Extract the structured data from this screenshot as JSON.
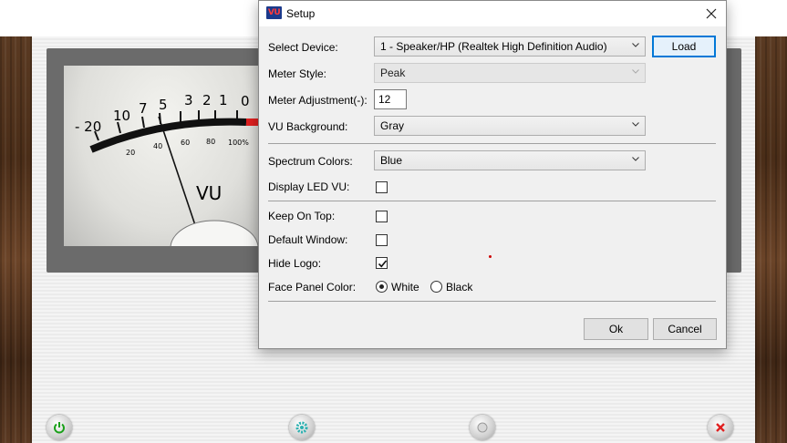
{
  "dialog": {
    "title": "Setup",
    "app_icon_text": "VU",
    "labels": {
      "select_device": "Select Device:",
      "meter_style": "Meter Style:",
      "meter_adjustment": "Meter Adjustment(-):",
      "vu_background": "VU Background:",
      "spectrum_colors": "Spectrum Colors:",
      "display_led_vu": "Display LED VU:",
      "keep_on_top": "Keep On Top:",
      "default_window": "Default Window:",
      "hide_logo": "Hide Logo:",
      "face_panel_color": "Face Panel Color:"
    },
    "values": {
      "select_device": "1 - Speaker/HP (Realtek High Definition Audio)",
      "meter_style": "Peak",
      "meter_adjustment": "12",
      "vu_background": "Gray",
      "spectrum_colors": "Blue"
    },
    "checkboxes": {
      "display_led_vu": false,
      "keep_on_top": false,
      "default_window": false,
      "hide_logo": true
    },
    "face_panel_options": [
      "White",
      "Black"
    ],
    "face_panel_selected": "White",
    "buttons": {
      "load": "Load",
      "ok": "Ok",
      "cancel": "Cancel"
    }
  },
  "meter": {
    "scale_top": [
      "- 20",
      "10",
      "7",
      "5",
      "3",
      "2",
      "1",
      "0"
    ],
    "scale_bottom": [
      "20",
      "40",
      "60",
      "80",
      "100%"
    ],
    "label": "VU"
  },
  "bottom_buttons": [
    "power-icon",
    "settings-icon",
    "info-icon",
    "close-icon"
  ],
  "colors": {
    "accent": "#0078d7",
    "meter_red": "#e02020",
    "wood": "#4a2d18"
  }
}
